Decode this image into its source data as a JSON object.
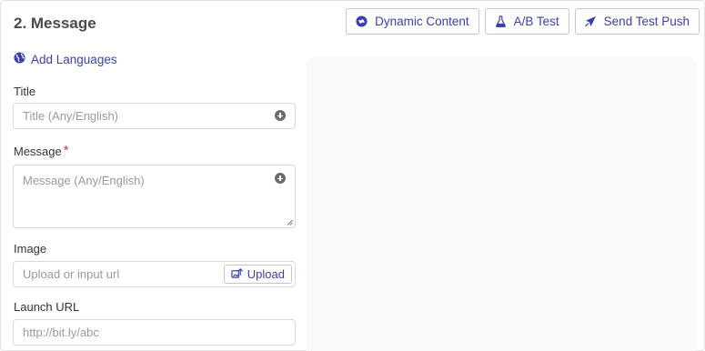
{
  "section": {
    "title": "2. Message"
  },
  "actions": {
    "dynamic_content": "Dynamic Content",
    "ab_test": "A/B Test",
    "send_test_push": "Send Test Push"
  },
  "add_languages": "Add Languages",
  "fields": {
    "title": {
      "label": "Title",
      "placeholder": "Title (Any/English)",
      "value": ""
    },
    "message": {
      "label": "Message",
      "required_mark": "*",
      "placeholder": "Message (Any/English)",
      "value": ""
    },
    "image": {
      "label": "Image",
      "placeholder": "Upload or input url",
      "value": "",
      "upload_label": "Upload"
    },
    "launch_url": {
      "label": "Launch URL",
      "placeholder": "http://bit.ly/abc",
      "value": ""
    }
  },
  "colors": {
    "accent": "#3a3fae",
    "border": "#d9d9dc",
    "required": "#d9363e",
    "preview_bg": "#f9f9f9"
  },
  "icons": {
    "dynamic_content": "dynamic-content-icon",
    "ab_test": "flask-icon",
    "send_test_push": "send-icon",
    "add_languages": "globe-icon",
    "add_field_content": "plus-circle-icon",
    "upload": "upload-image-icon"
  }
}
